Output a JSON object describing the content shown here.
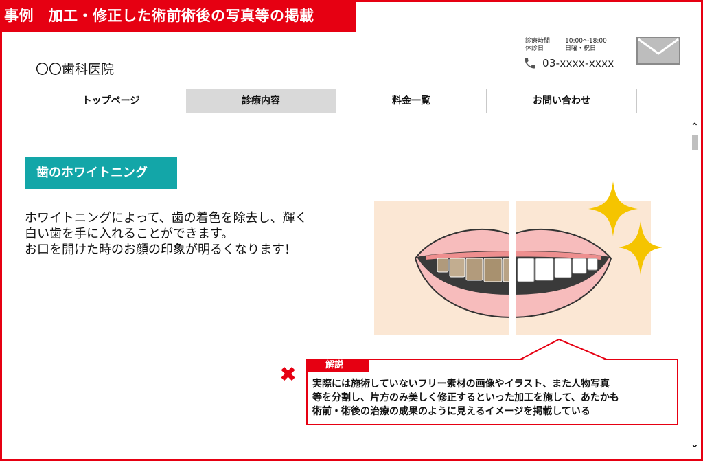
{
  "banner": {
    "title": "事例　加工・修正した術前術後の写真等の掲載"
  },
  "header": {
    "clinic_name": "〇〇歯科医院",
    "hours": [
      {
        "label": "診療時間",
        "value": "10:00～18:00"
      },
      {
        "label": "休診日",
        "value": "日曜・祝日"
      }
    ],
    "phone": "03-xxxx-xxxx",
    "mail_icon": "mail-icon"
  },
  "nav": [
    {
      "label": "トップページ",
      "active": false
    },
    {
      "label": "診療内容",
      "active": true
    },
    {
      "label": "料金一覧",
      "active": false
    },
    {
      "label": "お問い合わせ",
      "active": false
    }
  ],
  "section": {
    "title": "歯のホワイトニング",
    "lines": [
      "ホワイトニングによって、歯の着色を除去し、輝く",
      "白い歯を手に入れることができます。",
      "お口を開けた時のお顔の印象が明るくなります！"
    ]
  },
  "callout": {
    "tag": "解説",
    "lines": [
      "実際には施術していないフリー素材の画像やイラスト、また人物写真",
      "等を分割し、片方のみ美しく修正するといった加工を施して、あたかも",
      "術前・術後の治療の成果のように見えるイメージを掲載している"
    ],
    "mark": "✖"
  },
  "colors": {
    "accent_red": "#e60012",
    "teal": "#13a6a8",
    "nav_active": "#d9d9d9"
  }
}
